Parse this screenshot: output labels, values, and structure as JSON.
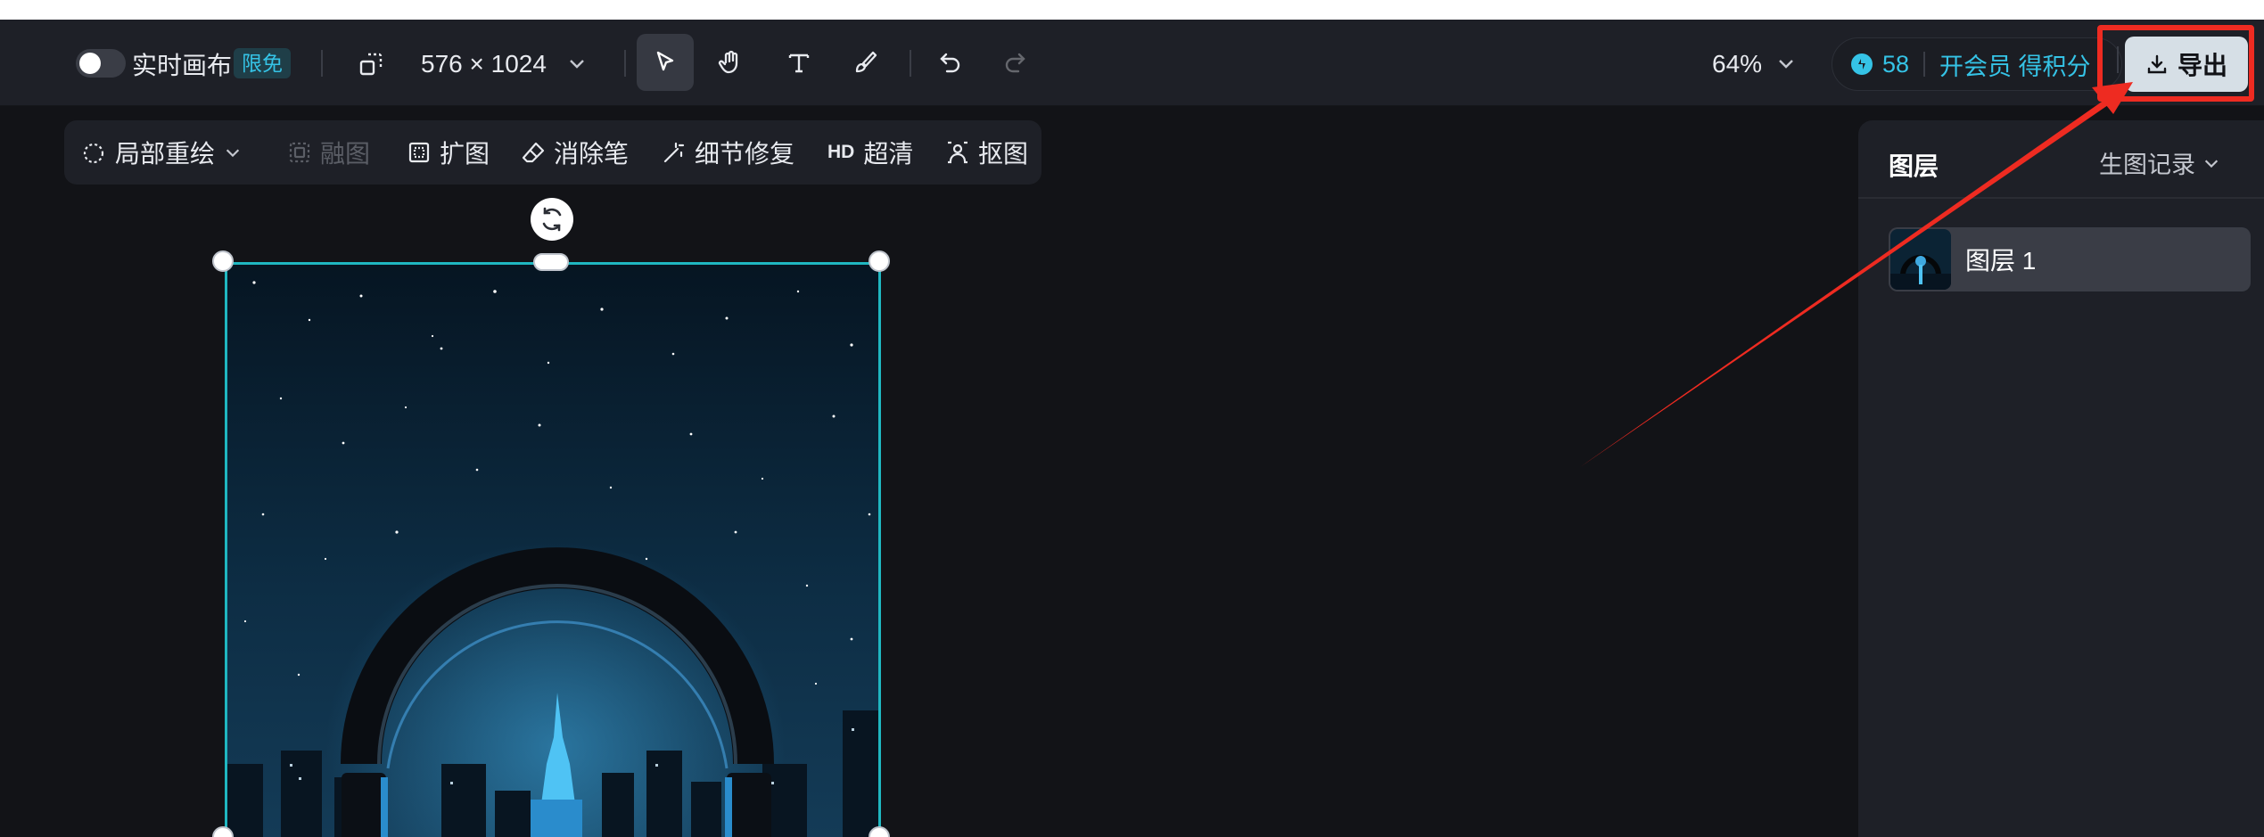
{
  "toolbar": {
    "realtime_label": "实时画布",
    "free_badge": "限免",
    "canvas_size": "576 × 1024",
    "zoom": "64%",
    "credits": "58",
    "vip_label": "开会员 得积分",
    "export_label": "导出"
  },
  "subtoolbar": {
    "inpaint": "局部重绘",
    "blend": "融图",
    "expand": "扩图",
    "eraser": "消除笔",
    "detail_fix": "细节修复",
    "hd_tag": "HD",
    "upscale": "超清",
    "cutout": "抠图"
  },
  "right_panel": {
    "title": "图层",
    "history": "生图记录",
    "layers": [
      {
        "label": "图层 1"
      }
    ]
  },
  "colors": {
    "accent": "#35c3e6",
    "selection": "#1fb7c1",
    "annotation": "#ee2b21",
    "export_bg": "#d6dfe6"
  }
}
